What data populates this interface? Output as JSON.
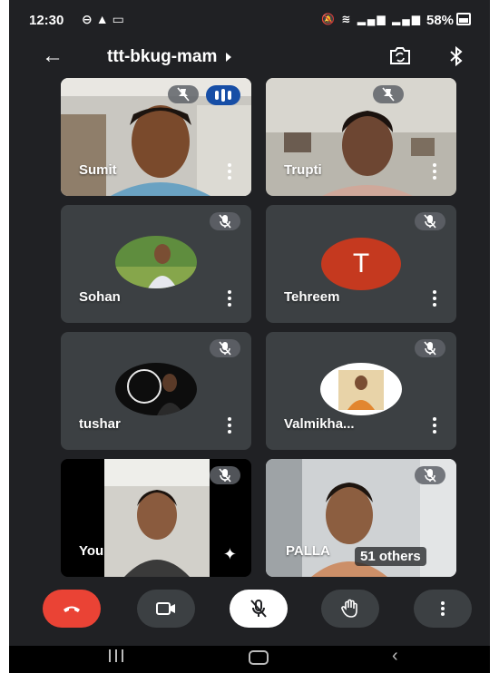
{
  "status_bar": {
    "time": "12:30",
    "battery": "58%",
    "left_icons": [
      "do-not-disturb-icon",
      "alert-triangle-icon",
      "cast-icon"
    ],
    "right_icons": [
      "mute-icon",
      "wifi-icon",
      "volte-lte1-icon",
      "volte-lte2-icon",
      "battery-icon"
    ]
  },
  "header": {
    "meeting_code": "ttt-bkug-mam"
  },
  "participants": [
    {
      "name": "Sumit",
      "status": "speaking",
      "type": "video"
    },
    {
      "name": "Trupti",
      "status": "muted",
      "type": "video"
    },
    {
      "name": "Sohan",
      "status": "muted",
      "type": "photo"
    },
    {
      "name": "Tehreem",
      "status": "muted",
      "type": "letter",
      "initial": "T",
      "color": "#c5391f"
    },
    {
      "name": "tushar",
      "status": "muted",
      "type": "photo"
    },
    {
      "name": "Valmikha...",
      "status": "muted",
      "type": "photo"
    },
    {
      "name": "You",
      "status": "muted",
      "type": "video"
    },
    {
      "name": "PALLA",
      "status": "muted",
      "type": "video",
      "others_label": "51 others"
    }
  ],
  "controls": {
    "end_call_color": "#ea4335",
    "icons": [
      "end-call-icon",
      "camera-icon",
      "mic-off-icon",
      "raise-hand-icon",
      "more-options-icon"
    ]
  },
  "colors": {
    "background": "#202124",
    "tile": "#3c4043",
    "speaking_badge": "#174ea6"
  }
}
